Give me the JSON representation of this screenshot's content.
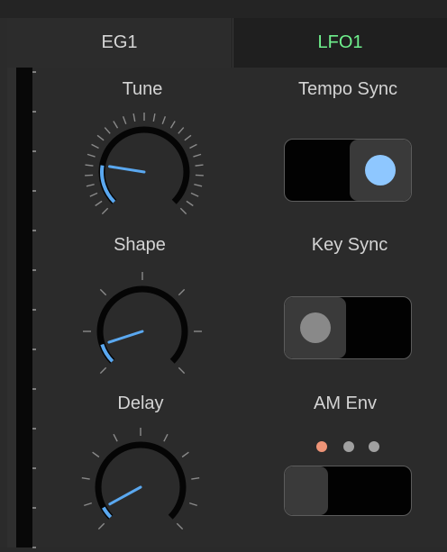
{
  "tabs": [
    {
      "label": "EG1",
      "active": false
    },
    {
      "label": "LFO1",
      "active": true
    }
  ],
  "knobs": [
    {
      "label": "Tune",
      "value": 0.2,
      "color": "#5aa8f0"
    },
    {
      "label": "Shape",
      "value": 0.1,
      "color": "#5aa8f0"
    },
    {
      "label": "Delay",
      "value": 0.06,
      "color": "#5aa8f0"
    }
  ],
  "switches": {
    "tempo_sync": {
      "label": "Tempo Sync",
      "on": true
    },
    "key_sync": {
      "label": "Key Sync",
      "on": false
    },
    "am_env": {
      "label": "AM Env",
      "mode_count": 3,
      "selected_mode": 1
    }
  },
  "colors": {
    "accent_green": "#6ff08d",
    "accent_blue": "#5aa8f0",
    "env_active": "#ee9477"
  }
}
